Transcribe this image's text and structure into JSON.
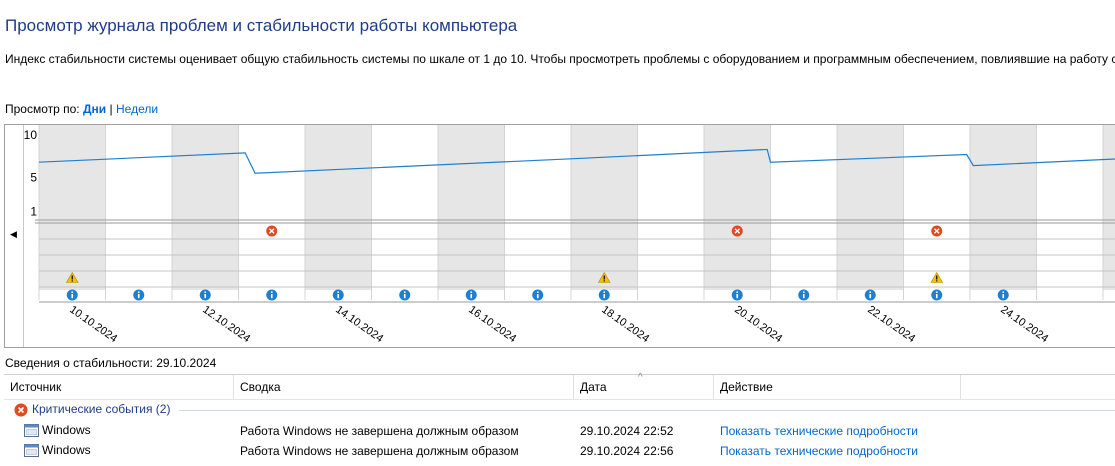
{
  "page": {
    "title": "Просмотр журнала проблем и стабильности работы компьютера",
    "description": "Индекс стабильности системы оценивает общую стабильность системы по шкале от 1 до 10. Чтобы просмотреть проблемы с оборудованием и программным обеспечением, повлиявшие на работу с"
  },
  "view_by": {
    "label": "Просмотр по:",
    "days": "Дни",
    "separator": "|",
    "weeks": "Недели"
  },
  "chart": {
    "y_ticks": [
      "10",
      "5",
      "1"
    ],
    "dates": [
      "10.10.2024",
      "12.10.2024",
      "14.10.2024",
      "16.10.2024",
      "18.10.2024",
      "20.10.2024",
      "22.10.2024",
      "24.10.2024"
    ],
    "day_count": 17,
    "stability_index": [
      {
        "day": 0,
        "value": 6.8
      },
      {
        "day": 3.1,
        "value": 7.9
      },
      {
        "day": 3.25,
        "value": 5.5
      },
      {
        "day": 8.0,
        "value": 7.2
      },
      {
        "day": 10.95,
        "value": 8.3
      },
      {
        "day": 11.0,
        "value": 6.8
      },
      {
        "day": 13.95,
        "value": 7.7
      },
      {
        "day": 14.05,
        "value": 6.4
      },
      {
        "day": 16.8,
        "value": 7.4
      }
    ],
    "critical_events_days": [
      3,
      10,
      13
    ],
    "warning_days": [
      0,
      8,
      13
    ],
    "info_days": [
      0,
      1,
      2,
      3,
      4,
      5,
      6,
      7,
      8,
      10,
      11,
      12,
      13,
      14
    ],
    "line_color": "#1e7fd1",
    "critical_color": "#e04a1c",
    "warning_color": "#f2c200",
    "info_color": "#1e7fd1"
  },
  "stability_info": "Сведения о стабильности: 29.10.2024",
  "table": {
    "headers": {
      "source": "Источник",
      "summary": "Сводка",
      "date": "Дата",
      "action": "Действие"
    },
    "sort_indicator": "^",
    "group_label": "Критические события (2)",
    "rows": [
      {
        "source": "Windows",
        "summary": "Работа Windows не завершена должным образом",
        "date": "29.10.2024 22:52",
        "action": "Показать технические подробности"
      },
      {
        "source": "Windows",
        "summary": "Работа Windows не завершена должным образом",
        "date": "29.10.2024 22:56",
        "action": "Показать технические подробности"
      }
    ]
  }
}
